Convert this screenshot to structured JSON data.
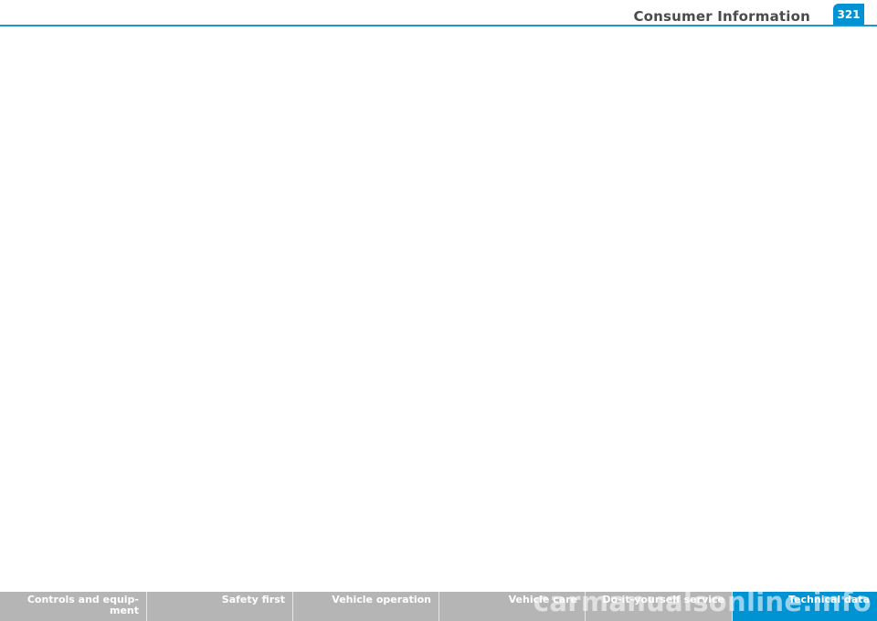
{
  "header": {
    "section_title": "Consumer Information",
    "page_number": "321"
  },
  "footer_nav": {
    "tabs": [
      {
        "line1": "Controls and equip-",
        "line2": "ment"
      },
      {
        "line1": "Safety first",
        "line2": ""
      },
      {
        "line1": "Vehicle operation",
        "line2": ""
      },
      {
        "line1": "Vehicle care",
        "line2": ""
      },
      {
        "line1": "Do-it-yourself service",
        "line2": ""
      },
      {
        "line1": "Technical data",
        "line2": ""
      }
    ],
    "active_tab": "Technical data"
  },
  "watermark": "carmanualsonline.info",
  "colors": {
    "accent": "#0093d3",
    "tab_gray": "#b5b5b5",
    "title_text": "#4b4b4b"
  }
}
